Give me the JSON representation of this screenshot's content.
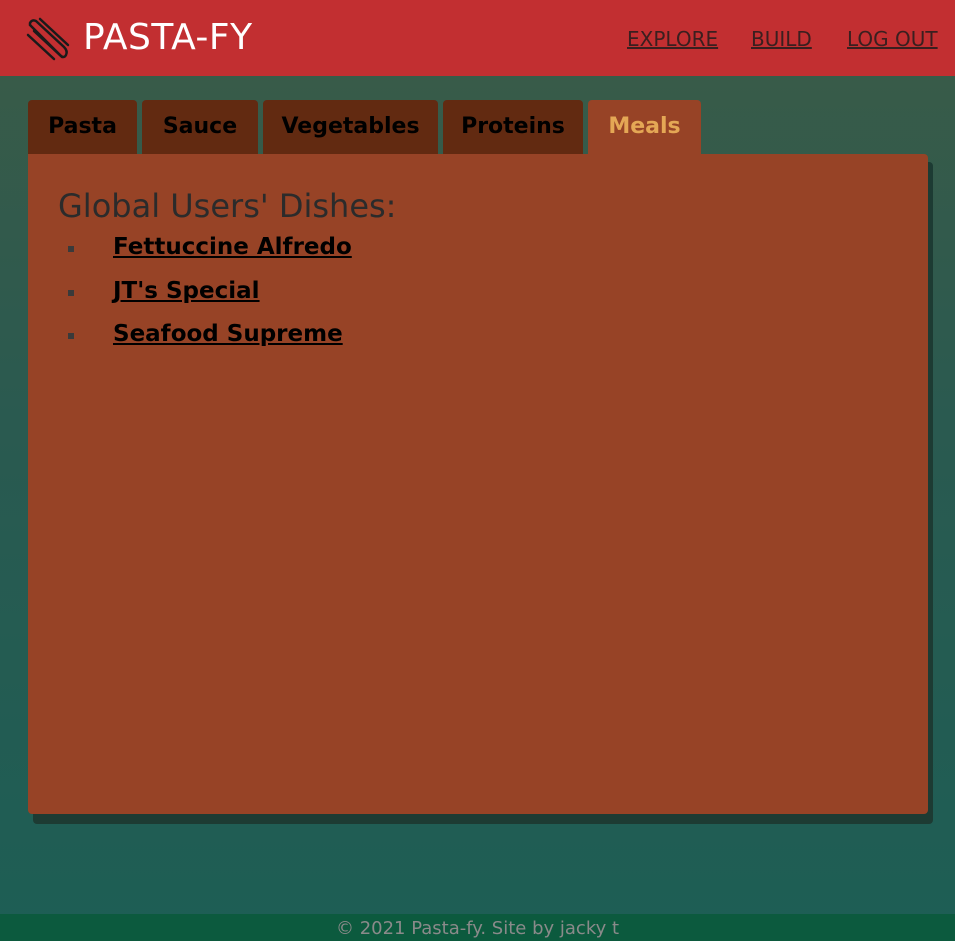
{
  "header": {
    "brand": "PASTA-FY",
    "nav": [
      {
        "label": "EXPLORE"
      },
      {
        "label": "BUILD"
      },
      {
        "label": "LOG OUT"
      }
    ],
    "logo_icon": "pasta-icon"
  },
  "tabs": [
    {
      "label": "Pasta",
      "active": false
    },
    {
      "label": "Sauce",
      "active": false
    },
    {
      "label": "Vegetables",
      "active": false
    },
    {
      "label": "Proteins",
      "active": false
    },
    {
      "label": "Meals",
      "active": true
    }
  ],
  "panel": {
    "title": "Global Users' Dishes:",
    "dishes": [
      {
        "label": "Fettuccine Alfredo"
      },
      {
        "label": "JT's Special"
      },
      {
        "label": "Seafood Supreme"
      }
    ]
  },
  "footer": {
    "text": "© 2021 Pasta-fy. Site by jacky t"
  },
  "colors": {
    "header": "#c22f31",
    "tab": "#622a11",
    "panel": "#974326",
    "active_tab_text": "#e4a755",
    "footer": "#0c5a3e"
  }
}
